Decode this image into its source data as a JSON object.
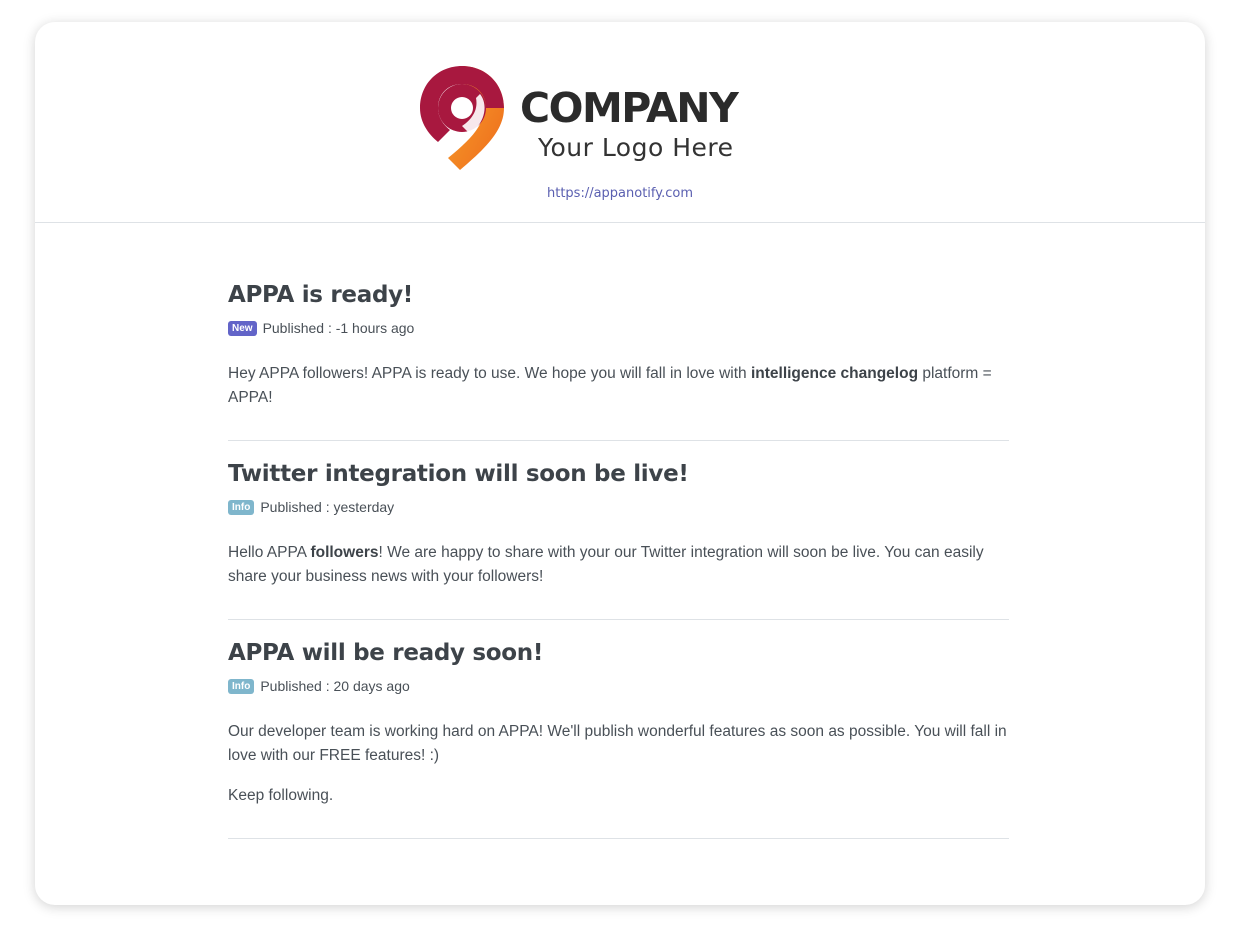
{
  "header": {
    "logo_title": "COMPANY",
    "logo_subtitle": "Your Logo Here",
    "site_link": "https://appanotify.com",
    "colors": {
      "brand_orange": "#f38a1f",
      "brand_crimson": "#a8183f"
    }
  },
  "posts": [
    {
      "title": "APPA is ready!",
      "badge": "New",
      "published": "Published : -1 hours ago",
      "paragraphs": [
        {
          "pre": "Hey APPA followers! APPA is ready to use. We hope you will fall in love with ",
          "bold": "intelligence changelog",
          "post": " platform = APPA!"
        }
      ]
    },
    {
      "title": "Twitter integration will soon be live!",
      "badge": "Info",
      "published": "Published : yesterday",
      "paragraphs": [
        {
          "pre": "Hello APPA ",
          "bold": "followers",
          "post": "! We are happy to share with your our Twitter integration will soon be live. You can easily share your business news with your followers!"
        }
      ]
    },
    {
      "title": "APPA will be ready soon!",
      "badge": "Info",
      "published": "Published : 20 days ago",
      "paragraphs": [
        {
          "text": "Our developer team is working hard on APPA! We'll publish wonderful features as soon as possible. You will fall in love with our FREE features! :)"
        },
        {
          "text": "Keep following."
        }
      ]
    }
  ],
  "colors": {
    "badge_new": "#6264c8",
    "badge_info": "#7fb6cc",
    "link": "#5a5fb0"
  }
}
